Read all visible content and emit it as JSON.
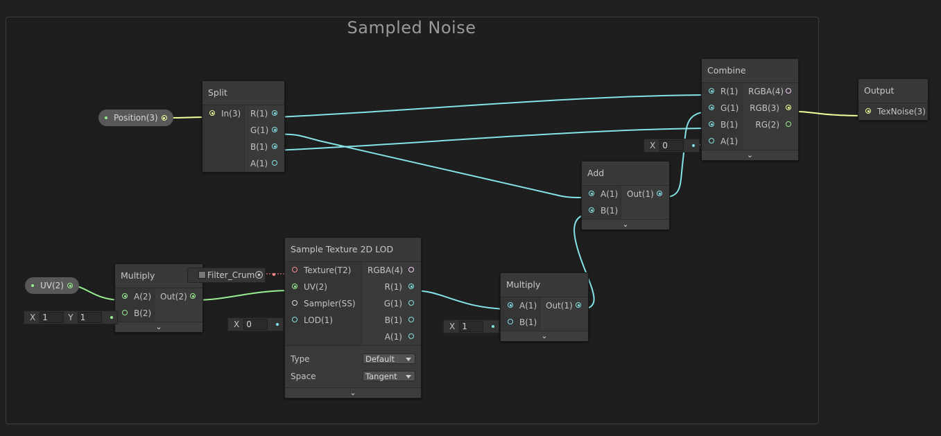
{
  "group": {
    "title": "Sampled Noise"
  },
  "pills": {
    "position": "Position(3)",
    "uv": "UV(2)"
  },
  "nodes": {
    "split": {
      "title": "Split",
      "inputs": [
        "In(3)"
      ],
      "outputs": [
        "R(1)",
        "G(1)",
        "B(1)",
        "A(1)"
      ]
    },
    "combine": {
      "title": "Combine",
      "inputs": [
        "R(1)",
        "G(1)",
        "B(1)",
        "A(1)"
      ],
      "outputs": [
        "RGBA(4)",
        "RGB(3)",
        "RG(2)"
      ]
    },
    "output": {
      "title": "Output",
      "inputs": [
        "TexNoise(3)"
      ]
    },
    "add": {
      "title": "Add",
      "inputs": [
        "A(1)",
        "B(1)"
      ],
      "outputs": [
        "Out(1)"
      ]
    },
    "multiply_uv": {
      "title": "Multiply",
      "inputs": [
        "A(2)",
        "B(2)"
      ],
      "outputs": [
        "Out(2)"
      ]
    },
    "sample_texture": {
      "title": "Sample Texture 2D LOD",
      "inputs": [
        "Texture(T2)",
        "UV(2)",
        "Sampler(SS)",
        "LOD(1)"
      ],
      "outputs": [
        "RGBA(4)",
        "R(1)",
        "G(1)",
        "B(1)",
        "A(1)"
      ],
      "props": [
        {
          "label": "Type",
          "value": "Default"
        },
        {
          "label": "Space",
          "value": "Tangent"
        }
      ]
    },
    "multiply_r": {
      "title": "Multiply",
      "inputs": [
        "A(1)",
        "B(1)"
      ],
      "outputs": [
        "Out(1)"
      ]
    }
  },
  "inline_fields": {
    "combine_a": {
      "x_label": "X",
      "x_value": "0"
    },
    "multiply_uv_b": {
      "x_label": "X",
      "x_value": "1",
      "y_label": "Y",
      "y_value": "1"
    },
    "lod": {
      "x_label": "X",
      "x_value": "0"
    },
    "multiply_r_b": {
      "x_label": "X",
      "x_value": "1"
    }
  },
  "texture_field": {
    "name": "Filter_Crum"
  },
  "expander_glyph": "⌄",
  "colors": {
    "background": "#202020",
    "group_border": "#3d3d3d",
    "wire_vector1": "#84e4e7",
    "wire_vector2": "#9aef92",
    "wire_vector3": "#f6ff9a",
    "wire_vector4": "#fbcbf4",
    "texture": "#ff8b8b"
  }
}
